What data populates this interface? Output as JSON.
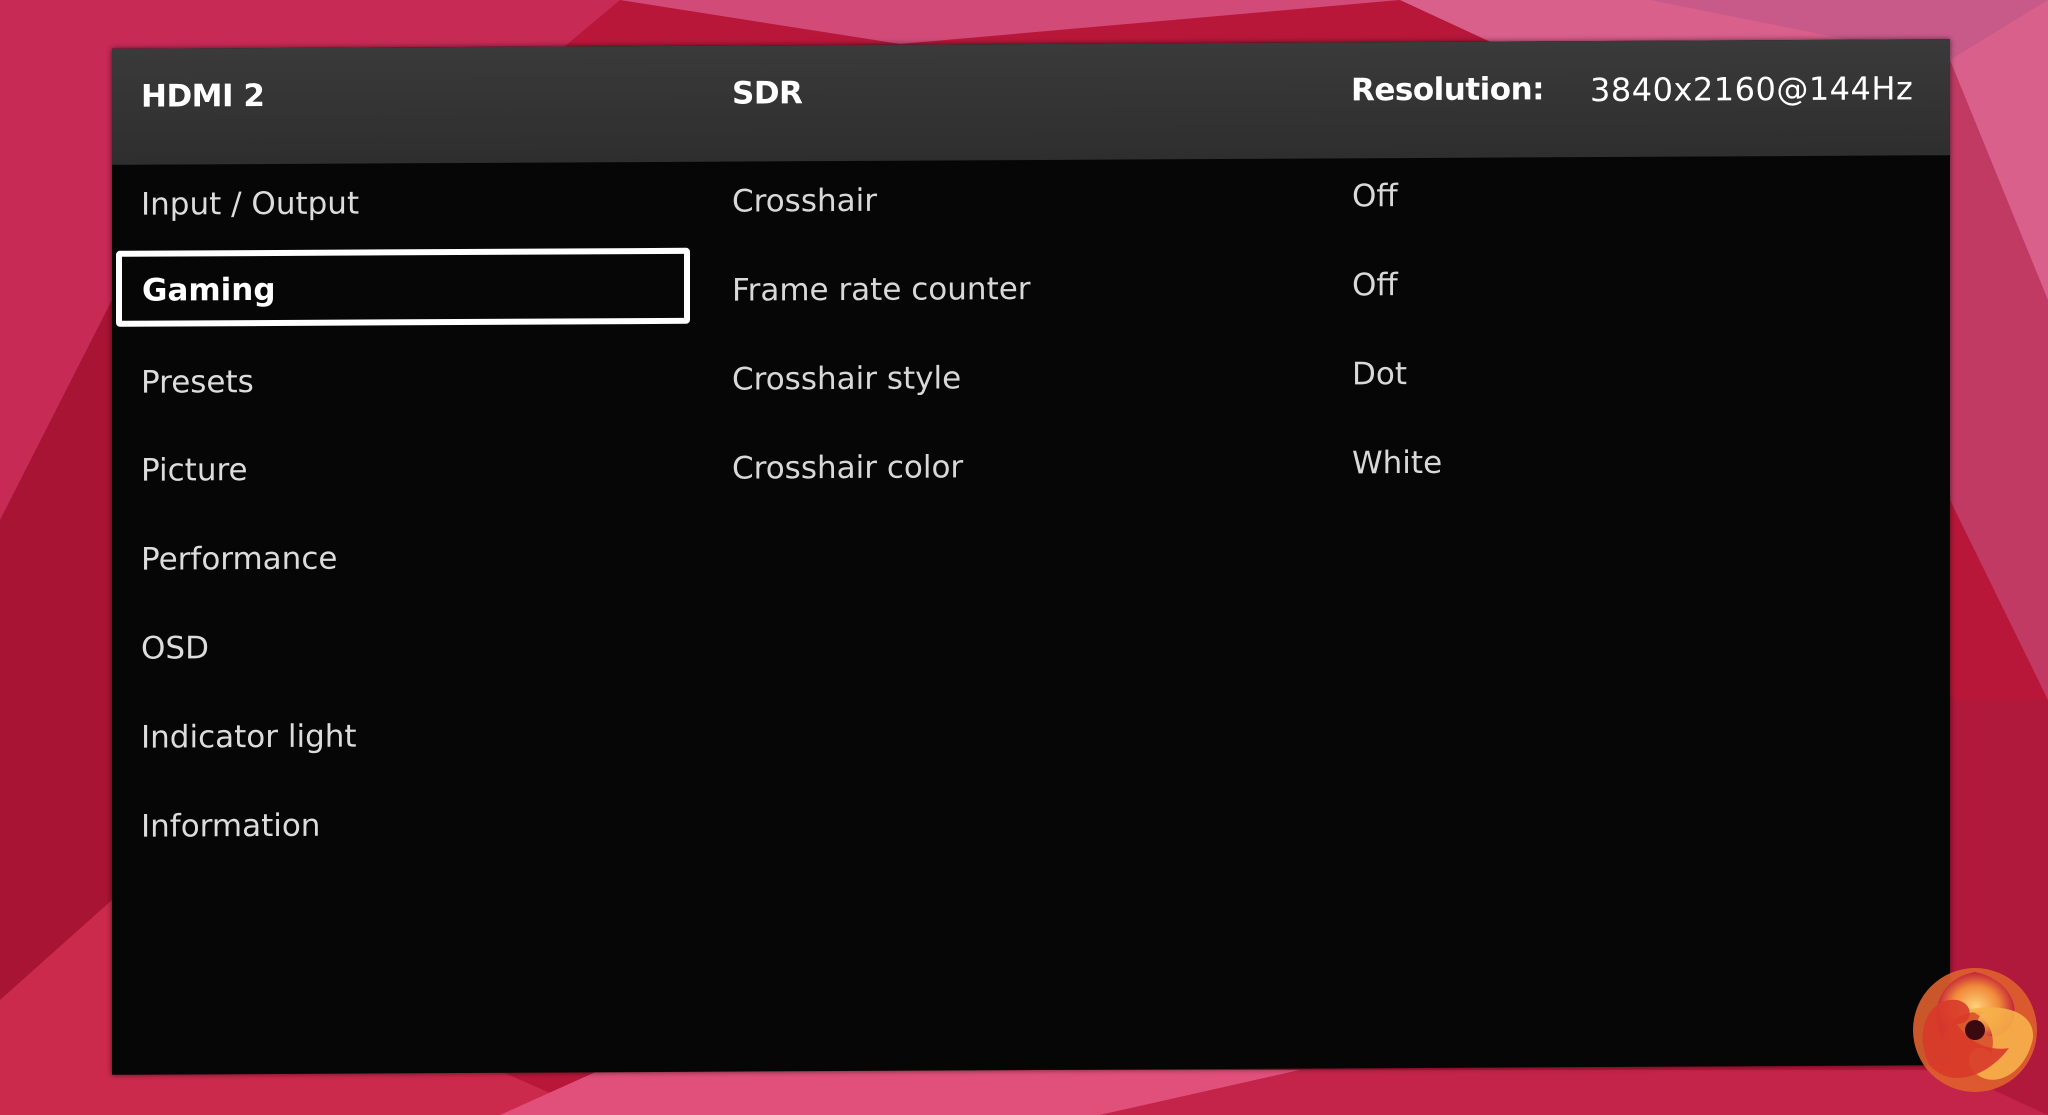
{
  "header": {
    "input": "HDMI 2",
    "mode": "SDR",
    "resolution_label": "Resolution:",
    "resolution_value": "3840x2160@144Hz"
  },
  "nav": {
    "items": [
      {
        "label": "Input / Output"
      },
      {
        "label": "Gaming",
        "selected": true
      },
      {
        "label": "Presets"
      },
      {
        "label": "Picture"
      },
      {
        "label": "Performance"
      },
      {
        "label": "OSD"
      },
      {
        "label": "Indicator light"
      },
      {
        "label": "Information"
      }
    ]
  },
  "options": [
    {
      "label": "Crosshair",
      "value": "Off"
    },
    {
      "label": "Frame rate counter",
      "value": "Off"
    },
    {
      "label": "Crosshair style",
      "value": "Dot"
    },
    {
      "label": "Crosshair color",
      "value": "White"
    }
  ],
  "colors": {
    "panel_bg": "#060606",
    "header_bg": "#333333",
    "wallpaper_primary": "#c41c40",
    "wallpaper_secondary": "#d9567a",
    "text": "#d8d8d8",
    "selected_border": "#ffffff"
  },
  "icons": {
    "watermark": "swirl-logo-icon"
  }
}
